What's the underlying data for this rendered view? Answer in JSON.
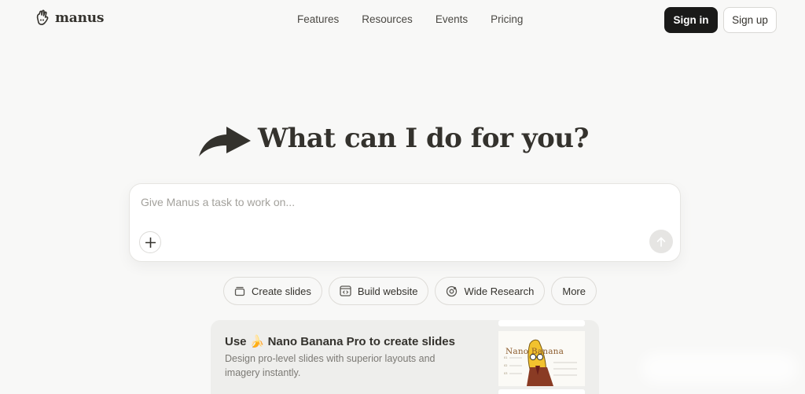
{
  "header": {
    "logo_text": "manus",
    "nav": [
      "Features",
      "Resources",
      "Events",
      "Pricing"
    ],
    "sign_in": "Sign in",
    "sign_up": "Sign up"
  },
  "hero": {
    "title": "What can I do for you?"
  },
  "task": {
    "placeholder": "Give Manus a task to work on...",
    "value": ""
  },
  "chips": {
    "create_slides": "Create slides",
    "build_website": "Build website",
    "wide_research": "Wide Research",
    "more": "More"
  },
  "promo": {
    "title_prefix": "Use",
    "emoji": "🍌",
    "title_suffix": "Nano Banana Pro to create slides",
    "desc": "Design pro-level slides with superior layouts and imagery instantly.",
    "thumb_title": "Nano Banana"
  },
  "colors": {
    "background": "#f8f8f7",
    "primary_button": "#1a1a19",
    "text": "#34322d",
    "muted_text": "#7b7974"
  }
}
